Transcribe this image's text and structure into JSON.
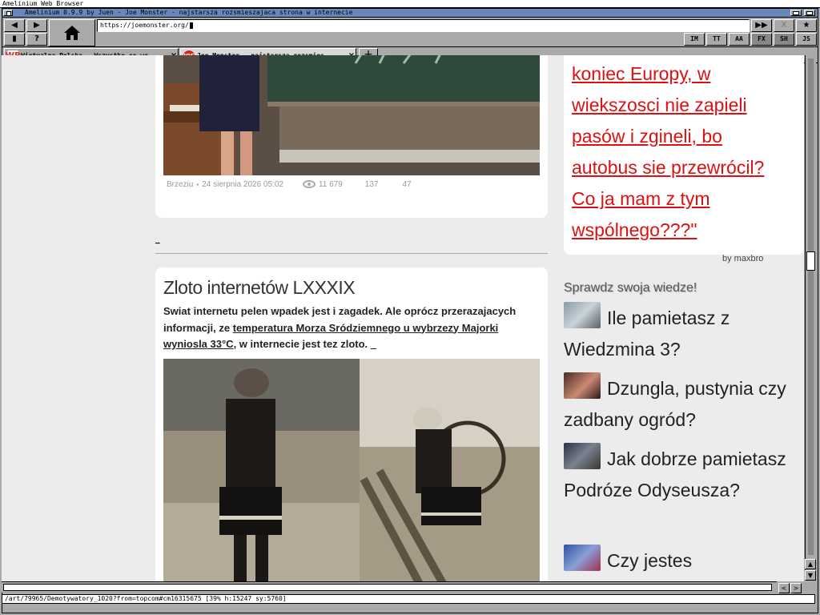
{
  "screen": {
    "title": "Amelinium Web Browser"
  },
  "window": {
    "title": "Amelinium 0.9.9 by Juen - Joe Monster - najstarsza rozsmieszajaca strona w internecie"
  },
  "toolbar": {
    "back": "◀",
    "forward": "▶",
    "bookmark": "▮",
    "help": "?",
    "go": "▶▶",
    "stop": "X",
    "favorite": "★",
    "url": "https://joemonster.org/",
    "modes": [
      {
        "label": "IM",
        "on": false
      },
      {
        "label": "TT",
        "on": false
      },
      {
        "label": "AA",
        "on": false
      },
      {
        "label": "FX",
        "on": true
      },
      {
        "label": "SH",
        "on": true
      },
      {
        "label": "JS",
        "on": false
      }
    ]
  },
  "tabs": [
    {
      "label": "Wirtualna Polska - Wszystko co wa...",
      "icon": "WP",
      "icon_color": "#e2231a",
      "active": false
    },
    {
      "label": "Joe Monster - najstarsza rozsmies...",
      "icon": "JOE",
      "icon_color": "#e2231a",
      "active": true
    }
  ],
  "new_tab": "+",
  "article_top": {
    "meta_author": "Brzeziu",
    "meta_date": "24 sierpnia 2026 05:02",
    "meta_views": "11 679",
    "meta_likes": "137",
    "meta_comments": "47"
  },
  "divider_link": "_",
  "article_main": {
    "title": "Zloto internetów LXXXIX",
    "lead_1": "Swiat internetu pelen wpadek jest i zagadek. Ale oprócz przerazajacych informacji, ze ",
    "lead_link": "temperatura Morza Sródziemnego u wybrzezy Majorki wyniosla 33°C,",
    "lead_2": " w internecie jest tez zloto. ",
    "lead_tail": "_"
  },
  "quote": {
    "lines": [
      "koniec Europy, w",
      "wiekszosci nie zapieli",
      "pasów i zgineli, bo",
      "autobus sie przewrócil?",
      "Co ja mam z tym",
      "wspólnego???\""
    ],
    "author": "by maxbro",
    "color": "#dd1111"
  },
  "quiz": {
    "heading": "Sprawdz swoja wiedze!",
    "items": [
      {
        "text": "Ile pamietasz z Wiedzmina 3?"
      },
      {
        "text": "Dzungla, pustynia czy zadbany ogród?"
      },
      {
        "text": "Jak dobrze pamietasz Podróze Odyseusza?"
      },
      {
        "text": "Czy jestes"
      }
    ]
  },
  "scroll": {
    "up": "▲",
    "down": "▼",
    "left": "<",
    "right": ">"
  },
  "status": "/art/79965/Demotywatory_1020?from=topcom#cm16315675  [39% h:15247 sy:5760]"
}
